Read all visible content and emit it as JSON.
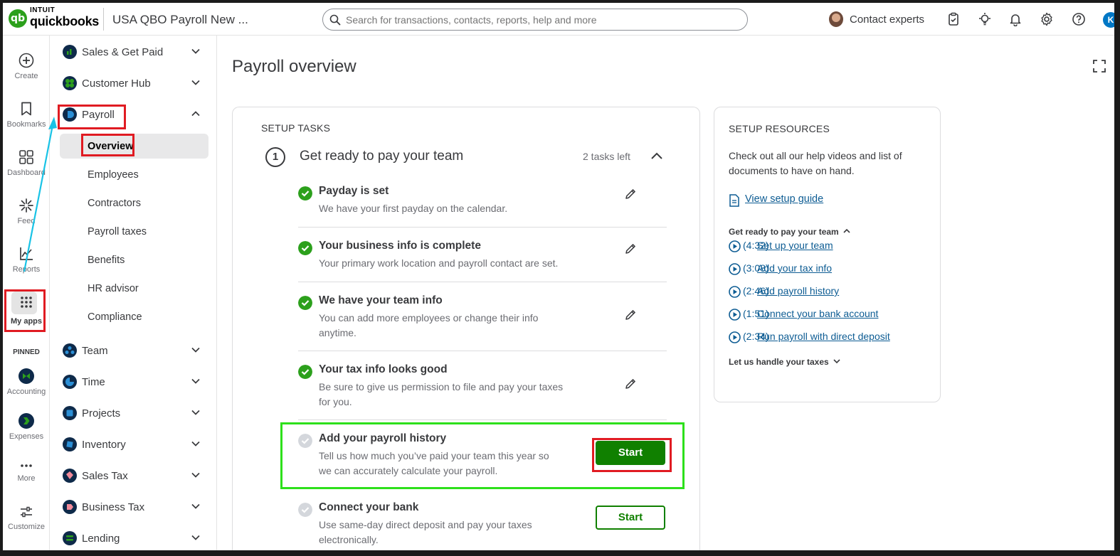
{
  "topbar": {
    "logo_intuit": "INTUIT",
    "logo_qb": "quickbooks",
    "company": "USA QBO Payroll New ...",
    "search_placeholder": "Search for transactions, contacts, reports, help and more",
    "contact_experts": "Contact experts",
    "user_initial": "K",
    "icons": [
      "search-icon",
      "checklist-icon",
      "lightbulb-icon",
      "bell-icon",
      "gear-icon",
      "help-icon"
    ]
  },
  "rail": {
    "create": "Create",
    "bookmarks": "Bookmarks",
    "dashboard": "Dashboard",
    "feed": "Feed",
    "reports": "Reports",
    "my_apps": "My apps",
    "pinned": "PINNED",
    "accounting": "Accounting",
    "expenses": "Expenses",
    "more": "More",
    "customize": "Customize"
  },
  "nav": {
    "items": [
      {
        "label": "Sales & Get Paid",
        "color": "#0e2a4a"
      },
      {
        "label": "Customer Hub",
        "color": "#0e2a4a"
      },
      {
        "label": "Payroll",
        "color": "#0e2a4a"
      },
      {
        "label": "Team",
        "color": "#0e2a4a"
      },
      {
        "label": "Time",
        "color": "#0e2a4a"
      },
      {
        "label": "Projects",
        "color": "#0e2a4a"
      },
      {
        "label": "Inventory",
        "color": "#0e2a4a"
      },
      {
        "label": "Sales Tax",
        "color": "#0e2a4a"
      },
      {
        "label": "Business Tax",
        "color": "#0e2a4a"
      },
      {
        "label": "Lending",
        "color": "#0e2a4a"
      }
    ],
    "payroll_sub": [
      "Overview",
      "Employees",
      "Contractors",
      "Payroll taxes",
      "Benefits",
      "HR advisor",
      "Compliance"
    ]
  },
  "main": {
    "title": "Payroll overview",
    "setup": {
      "label": "SETUP TASKS",
      "step_number": "1",
      "step_title": "Get ready to pay your team",
      "tasks_left": "2 tasks left",
      "tasks": [
        {
          "title": "Payday is set",
          "desc": "We have your first payday on the calendar.",
          "done": true
        },
        {
          "title": "Your business info is complete",
          "desc": "Your primary work location and payroll contact are set.",
          "done": true
        },
        {
          "title": "We have your team info",
          "desc": "You can add more employees or change their info anytime.",
          "done": true
        },
        {
          "title": "Your tax info looks good",
          "desc": "Be sure to give us permission to file and pay your taxes for you.",
          "done": true
        },
        {
          "title": "Add your payroll history",
          "desc": "Tell us how much you’ve paid your team this year so we can accurately calculate your payroll.",
          "done": false,
          "button": "Start"
        },
        {
          "title": "Connect your bank",
          "desc": "Use same-day direct deposit and pay your taxes electronically.",
          "done": false,
          "button": "Start"
        }
      ]
    },
    "resources": {
      "label": "SETUP RESOURCES",
      "desc": "Check out all our help videos and list of documents to have on hand.",
      "guide_link": "View setup guide",
      "section1": "Get ready to pay your team",
      "videos": [
        {
          "title": "Set up your team",
          "time": "(4:32)"
        },
        {
          "title": "Add your tax info",
          "time": "(3:08)"
        },
        {
          "title": "Add payroll history",
          "time": "(2:46)"
        },
        {
          "title": "Connect your bank account",
          "time": "(1:51)"
        },
        {
          "title": "Run payroll with direct deposit",
          "time": "(2:34)"
        }
      ],
      "section2": "Let us handle your taxes"
    }
  },
  "colors": {
    "brand_green": "#2ca01c",
    "button_green": "#108000",
    "link_blue": "#0d5c93",
    "annotation_red": "#e01b22",
    "annotation_green": "#2de01b",
    "annotation_cyan": "#19c3e6"
  }
}
